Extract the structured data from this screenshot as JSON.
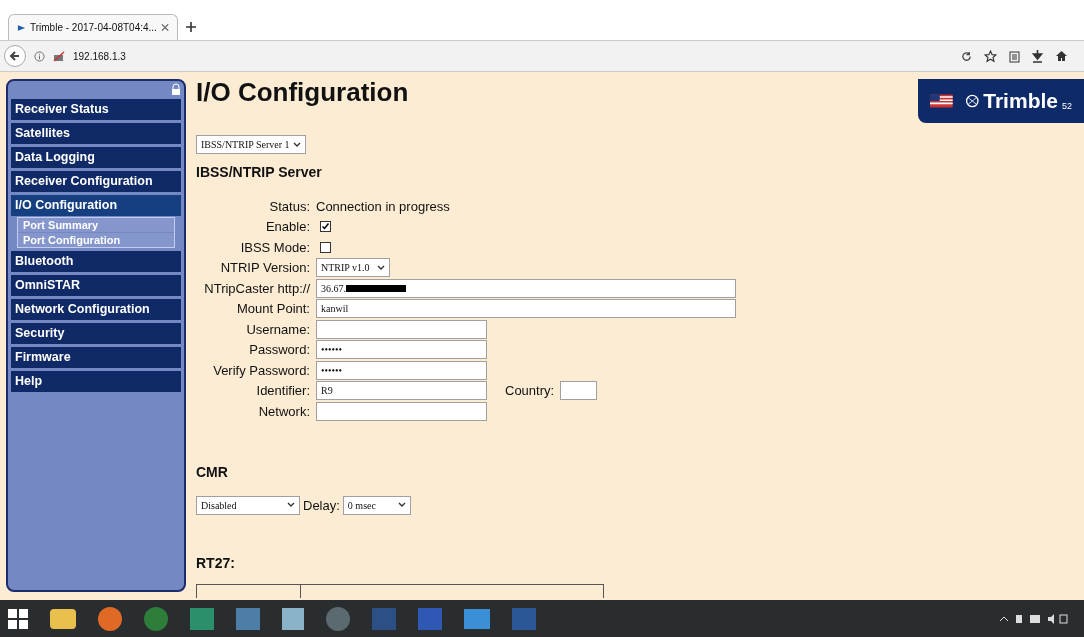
{
  "browser": {
    "tab_title": "Trimble - 2017-04-08T04:4...",
    "url": "192.168.1.3"
  },
  "sidebar": {
    "items": [
      {
        "label": "Receiver Status",
        "selected": false
      },
      {
        "label": "Satellites",
        "selected": false
      },
      {
        "label": "Data Logging",
        "selected": false
      },
      {
        "label": "Receiver Configuration",
        "selected": false
      },
      {
        "label": "I/O Configuration",
        "selected": true,
        "children": [
          {
            "label": "Port Summary"
          },
          {
            "label": "Port Configuration"
          }
        ]
      },
      {
        "label": "Bluetooth",
        "selected": false
      },
      {
        "label": "OmniSTAR",
        "selected": false
      },
      {
        "label": "Network Configuration",
        "selected": false
      },
      {
        "label": "Security",
        "selected": false
      },
      {
        "label": "Firmware",
        "selected": false
      },
      {
        "label": "Help",
        "selected": false
      }
    ]
  },
  "page": {
    "title": "I/O Configuration",
    "logo_text": "Trimble",
    "logo_suffix": "52",
    "port_select": "IBSS/NTRIP Server 1",
    "section_title": "IBSS/NTRIP Server",
    "fields": [
      {
        "kind": "text",
        "label": "Status:",
        "value": "Connection in progress"
      },
      {
        "kind": "checkbox",
        "label": "Enable:",
        "checked": true
      },
      {
        "kind": "checkbox",
        "label": "IBSS Mode:",
        "checked": false
      },
      {
        "kind": "select",
        "label": "NTRIP Version:",
        "value": "NTRIP v1.0"
      },
      {
        "kind": "redacted",
        "label": "NTripCaster http://",
        "value": "36.67."
      },
      {
        "kind": "wide",
        "label": "Mount Point:",
        "value": "kanwil"
      },
      {
        "kind": "input",
        "label": "Username:"
      },
      {
        "kind": "input",
        "label": "Password:",
        "value": "••••••"
      },
      {
        "kind": "input",
        "label": "Verify Password:",
        "value": "••••••"
      },
      {
        "kind": "input",
        "label": "Identifier:",
        "value": "R9",
        "extra_label": "Country:"
      },
      {
        "kind": "input",
        "label": "Network:"
      }
    ],
    "cmr": {
      "title": "CMR",
      "mode": "Disabled",
      "delay_label": "Delay:",
      "delay": "0 msec"
    },
    "rt27": {
      "title": "RT27:"
    }
  }
}
